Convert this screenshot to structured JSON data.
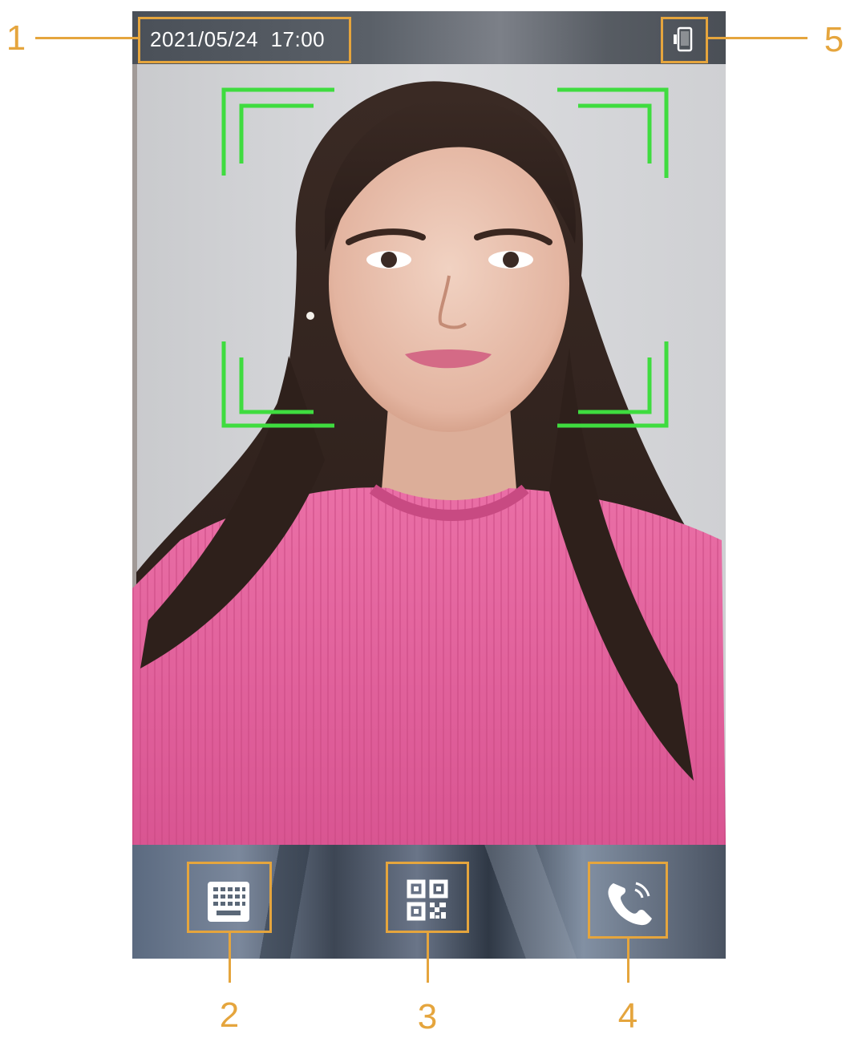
{
  "status_bar": {
    "datetime": "2021/05/24  17:00",
    "status_icon": "device-status-icon"
  },
  "camera_view": {
    "face_frame_color": "#3fdc3f"
  },
  "bottom_bar": {
    "buttons": [
      {
        "name": "keypad-button",
        "icon": "keypad-icon"
      },
      {
        "name": "qr-code-button",
        "icon": "qr-code-icon"
      },
      {
        "name": "call-button",
        "icon": "phone-icon"
      }
    ]
  },
  "callouts": [
    "1",
    "2",
    "3",
    "4",
    "5"
  ],
  "colors": {
    "callout": "#e5a53d",
    "face_frame": "#3fdc3f",
    "icon": "#ffffff"
  }
}
